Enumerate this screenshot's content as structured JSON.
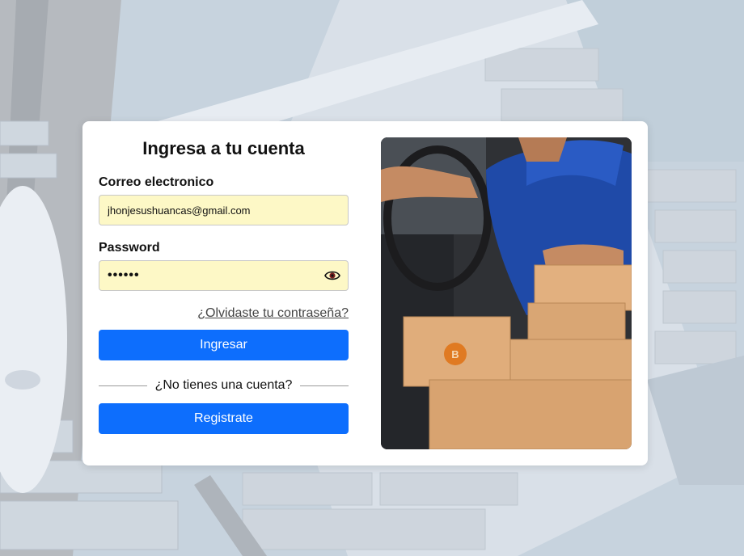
{
  "login": {
    "title": "Ingresa a tu cuenta",
    "email_label": "Correo electronico",
    "email_value": "jhonjesushuancas@gmail.com",
    "password_label": "Password",
    "password_value": "••••••",
    "forgot_link": "¿Olvidaste tu contraseña?",
    "login_button": "Ingresar",
    "divider_text": "¿No tienes una cuenta?",
    "register_button": "Registrate"
  },
  "icons": {
    "password_toggle": "eye-icon"
  },
  "colors": {
    "primary_button": "#0d6efd",
    "input_autofill_bg": "#fdf8c6",
    "card_bg": "#ffffff"
  },
  "images": {
    "background": "port-ships-aerial-photo",
    "side_panel": "delivery-man-with-boxes-photo"
  }
}
